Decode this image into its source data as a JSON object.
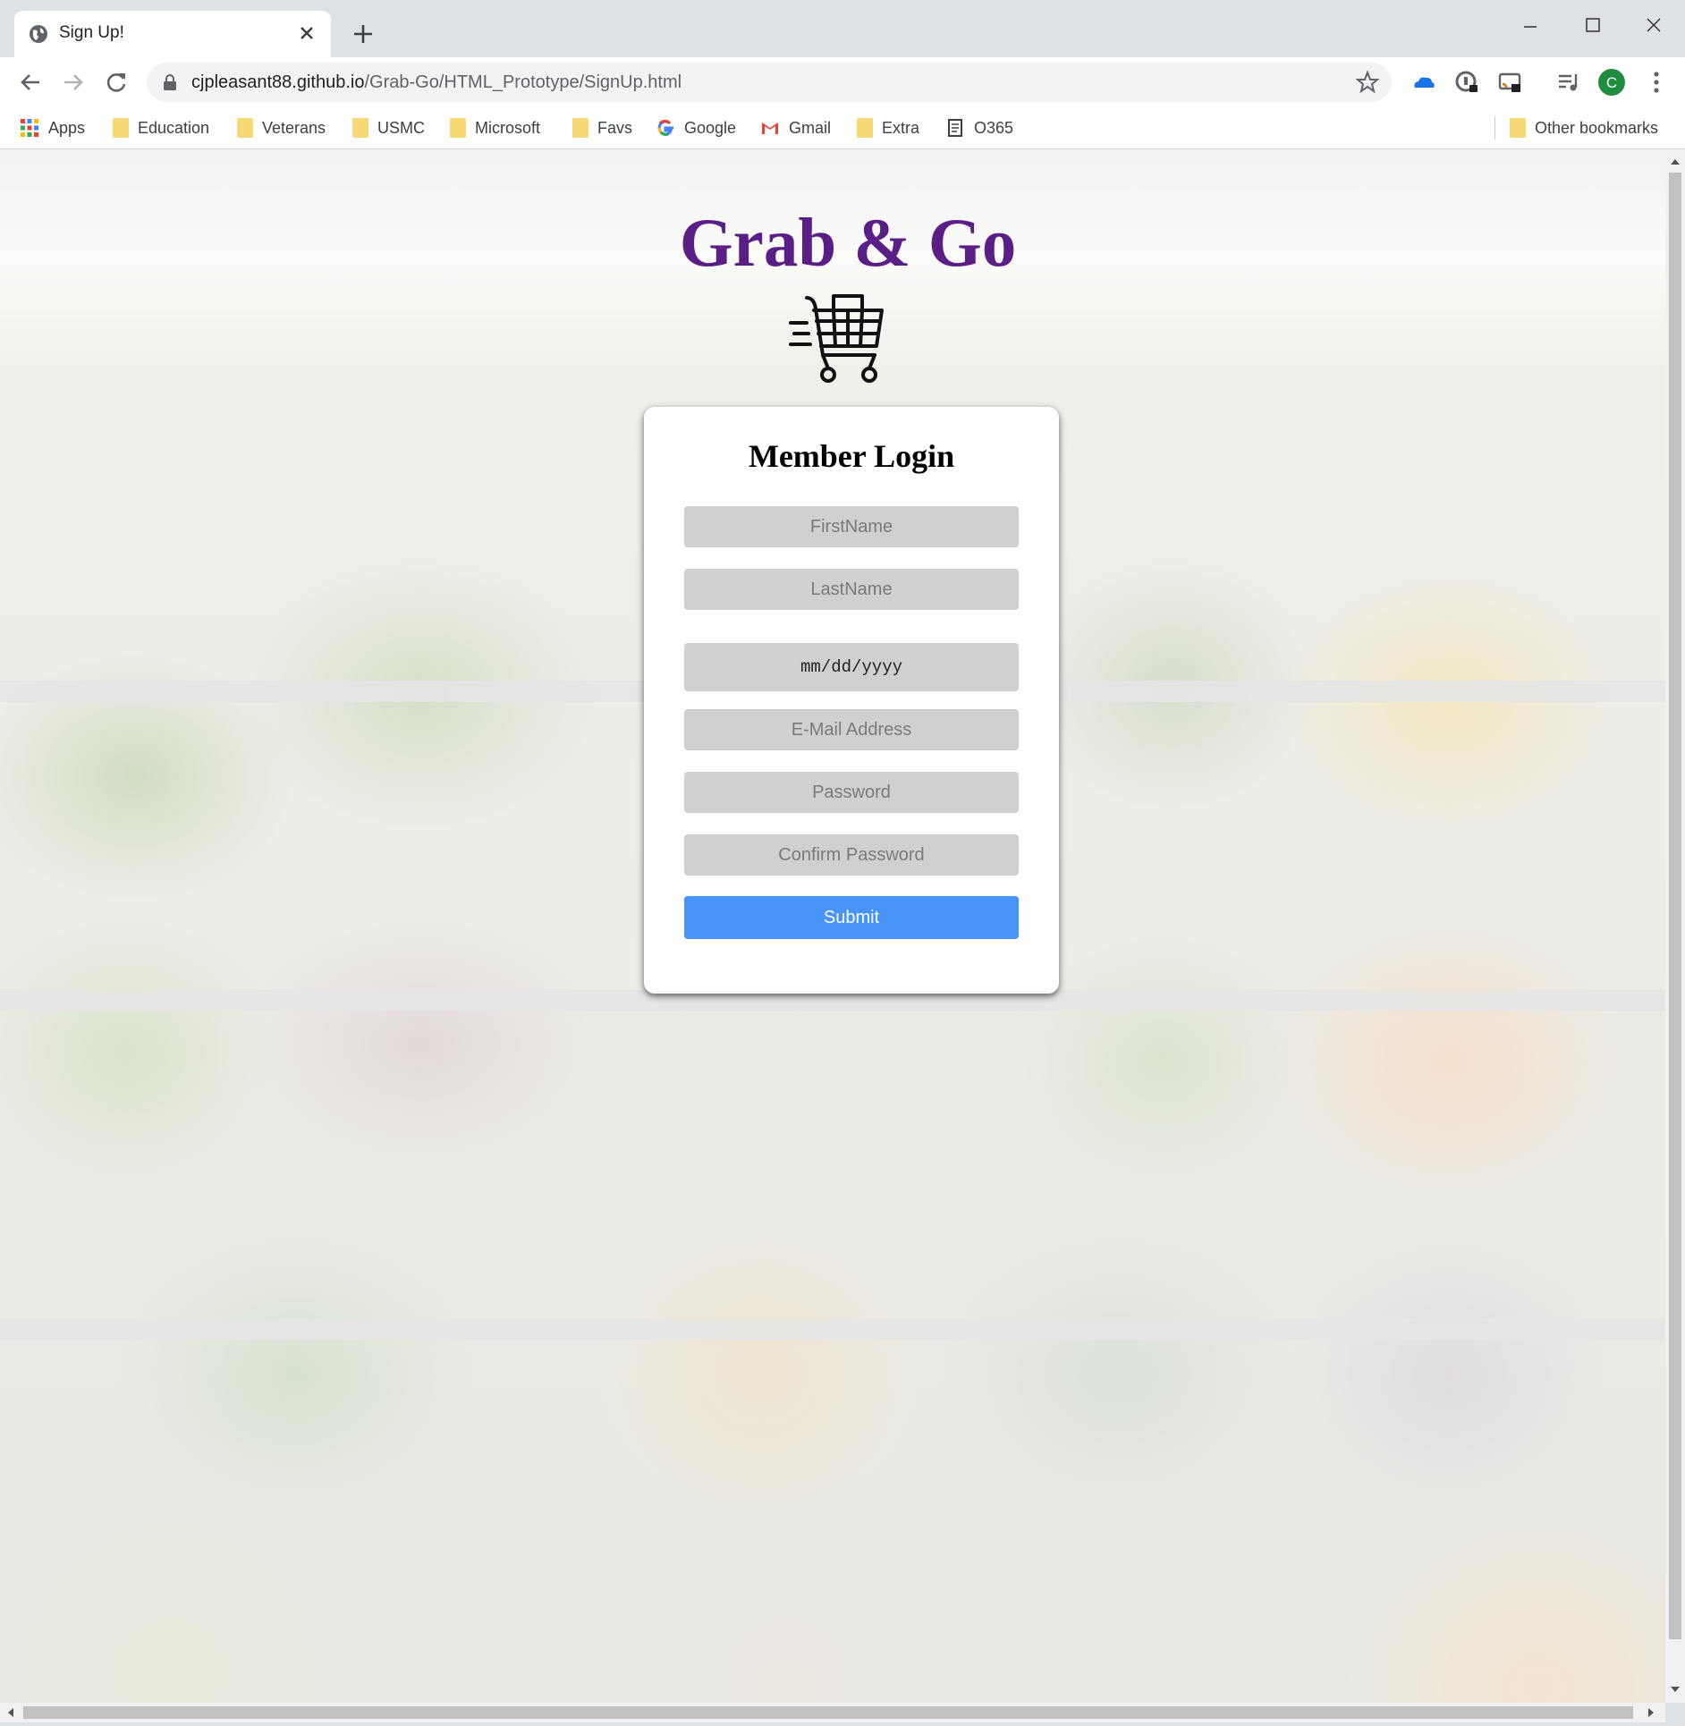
{
  "browser": {
    "tab_title": "Sign Up!",
    "url_host": "cjpleasant88.github.io",
    "url_path": "/Grab-Go/HTML_Prototype/SignUp.html",
    "profile_initial": "C",
    "profile_color": "#1e8e3e"
  },
  "bookmarks": {
    "items": [
      {
        "label": "Apps",
        "icon": "apps-grid-icon"
      },
      {
        "label": "Education",
        "icon": "folder-icon"
      },
      {
        "label": "Veterans",
        "icon": "folder-icon"
      },
      {
        "label": "USMC",
        "icon": "folder-icon"
      },
      {
        "label": "Microsoft",
        "icon": "folder-icon"
      },
      {
        "label": "Favs",
        "icon": "folder-icon"
      },
      {
        "label": "Google",
        "icon": "google-icon"
      },
      {
        "label": "Gmail",
        "icon": "gmail-icon"
      },
      {
        "label": "Extra",
        "icon": "folder-icon"
      },
      {
        "label": "O365",
        "icon": "page-icon"
      }
    ],
    "other": "Other bookmarks"
  },
  "page": {
    "brand": "Grab & Go",
    "brand_color": "#5a1f86",
    "form_title": "Member Login",
    "fields": {
      "first_name": "FirstName",
      "last_name": "LastName",
      "dob": "mm/dd/yyyy",
      "email": "E-Mail Address",
      "password": "Password",
      "confirm_password": "Confirm Password"
    },
    "submit_label": "Submit",
    "submit_color": "#4893f7"
  }
}
